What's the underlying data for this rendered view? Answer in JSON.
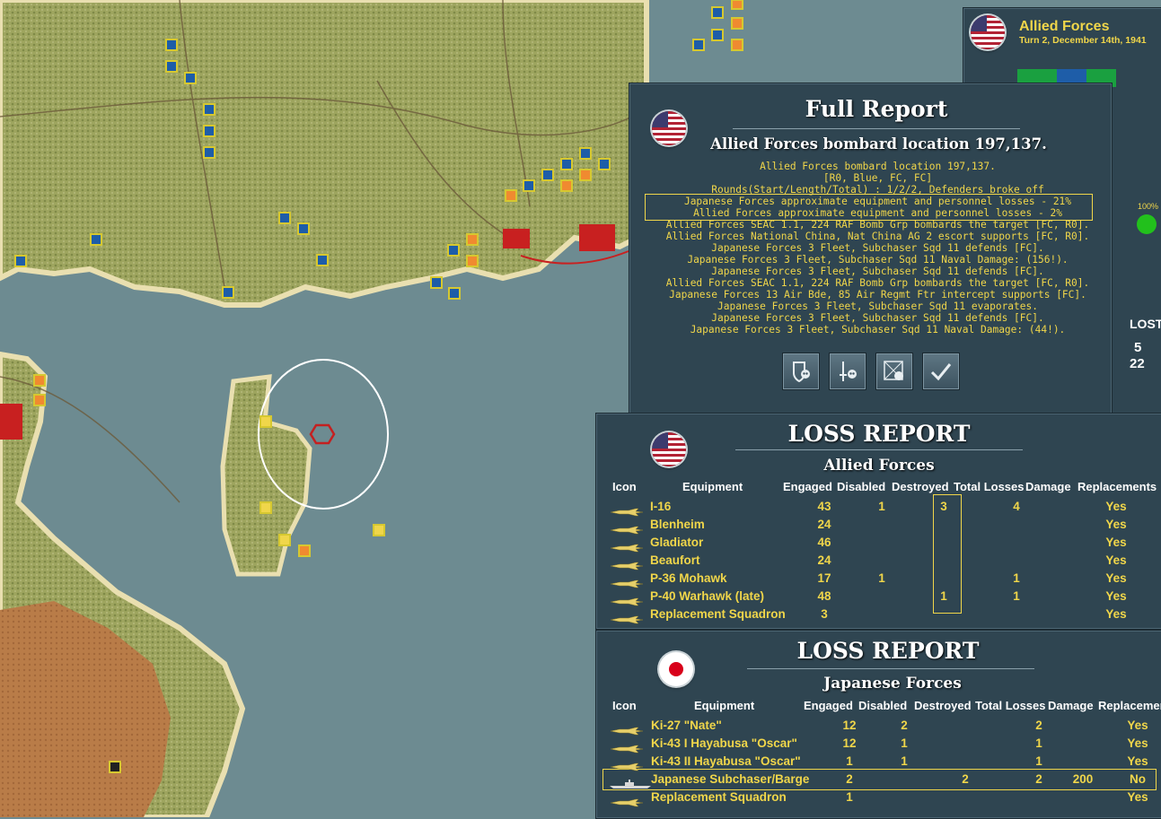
{
  "top_right": {
    "side": "Allied Forces",
    "turn": "Turn 2, December 14th, 1941",
    "readiness": "100%",
    "lost_header": "LOST",
    "lost_values": [
      "5",
      "22"
    ]
  },
  "full_report": {
    "title": "Full Report",
    "headline": "Allied Forces bombard location 197,137.",
    "lines": [
      "Allied Forces bombard location 197,137.",
      "[R0, Blue, FC, FC]",
      "Rounds(Start/Length/Total) : 1/2/2, Defenders broke off",
      "Japanese Forces approximate equipment and personnel losses - 21%",
      "Allied Forces approximate equipment and personnel losses - 2%",
      "Allied Forces SEAC 1.1, 224 RAF Bomb Grp bombards the target [FC, R0].",
      "Allied Forces National China, Nat China AG 2 escort supports [FC, R0].",
      "Japanese Forces 3 Fleet, Subchaser Sqd 11 defends [FC].",
      "Japanese Forces 3 Fleet, Subchaser Sqd 11 Naval Damage: (156!).",
      "Japanese Forces 3 Fleet, Subchaser Sqd 11 defends [FC].",
      "Allied Forces SEAC 1.1, 224 RAF Bomb Grp bombards the target [FC, R0].",
      "Japanese Forces 13 Air Bde, 85 Air Regmt Ftr intercept supports [FC].",
      "Japanese Forces 3 Fleet, Subchaser Sqd 11 evaporates.",
      "Japanese Forces 3 Fleet, Subchaser Sqd 11 defends [FC].",
      "Japanese Forces 3 Fleet, Subchaser Sqd 11 Naval Damage: (44!)."
    ],
    "buttons": [
      "shield-skull",
      "sword-skull",
      "map-skull",
      "confirm"
    ]
  },
  "allied_loss": {
    "title": "LOSS REPORT",
    "side": "Allied Forces",
    "columns": [
      "Icon",
      "Equipment",
      "Engaged",
      "Disabled",
      "Destroyed",
      "Total Losses",
      "Damage",
      "Replacements"
    ],
    "rows": [
      {
        "equipment": "I-16",
        "engaged": "43",
        "disabled": "1",
        "destroyed": "3",
        "total": "4",
        "damage": "",
        "replacements": "Yes"
      },
      {
        "equipment": "Blenheim",
        "engaged": "24",
        "disabled": "",
        "destroyed": "",
        "total": "",
        "damage": "",
        "replacements": "Yes"
      },
      {
        "equipment": "Gladiator",
        "engaged": "46",
        "disabled": "",
        "destroyed": "",
        "total": "",
        "damage": "",
        "replacements": "Yes"
      },
      {
        "equipment": "Beaufort",
        "engaged": "24",
        "disabled": "",
        "destroyed": "",
        "total": "",
        "damage": "",
        "replacements": "Yes"
      },
      {
        "equipment": "P-36 Mohawk",
        "engaged": "17",
        "disabled": "1",
        "destroyed": "",
        "total": "1",
        "damage": "",
        "replacements": "Yes"
      },
      {
        "equipment": "P-40 Warhawk (late)",
        "engaged": "48",
        "disabled": "",
        "destroyed": "1",
        "total": "1",
        "damage": "",
        "replacements": "Yes"
      },
      {
        "equipment": "Replacement Squadron",
        "engaged": "3",
        "disabled": "",
        "destroyed": "",
        "total": "",
        "damage": "",
        "replacements": "Yes"
      }
    ]
  },
  "japan_loss": {
    "title": "LOSS REPORT",
    "side": "Japanese Forces",
    "columns": [
      "Icon",
      "Equipment",
      "Engaged",
      "Disabled",
      "Destroyed",
      "Total Losses",
      "Damage",
      "Replacemen"
    ],
    "rows": [
      {
        "equipment": "Ki-27 \"Nate\"",
        "engaged": "12",
        "disabled": "2",
        "destroyed": "",
        "total": "2",
        "damage": "",
        "replacements": "Yes"
      },
      {
        "equipment": "Ki-43 I Hayabusa \"Oscar\"",
        "engaged": "12",
        "disabled": "1",
        "destroyed": "",
        "total": "1",
        "damage": "",
        "replacements": "Yes"
      },
      {
        "equipment": "Ki-43 II Hayabusa \"Oscar\"",
        "engaged": "1",
        "disabled": "1",
        "destroyed": "",
        "total": "1",
        "damage": "",
        "replacements": "Yes"
      },
      {
        "equipment": "Japanese Subchaser/Barge",
        "engaged": "2",
        "disabled": "",
        "destroyed": "2",
        "total": "2",
        "damage": "200",
        "replacements": "No"
      },
      {
        "equipment": "Replacement Squadron",
        "engaged": "1",
        "disabled": "",
        "destroyed": "",
        "total": "",
        "damage": "",
        "replacements": "Yes"
      }
    ]
  },
  "colors": {
    "panel": "#2f4551",
    "text_yellow": "#f0d64a",
    "sea": "#6d8b91",
    "land": "#a8ad6a"
  }
}
